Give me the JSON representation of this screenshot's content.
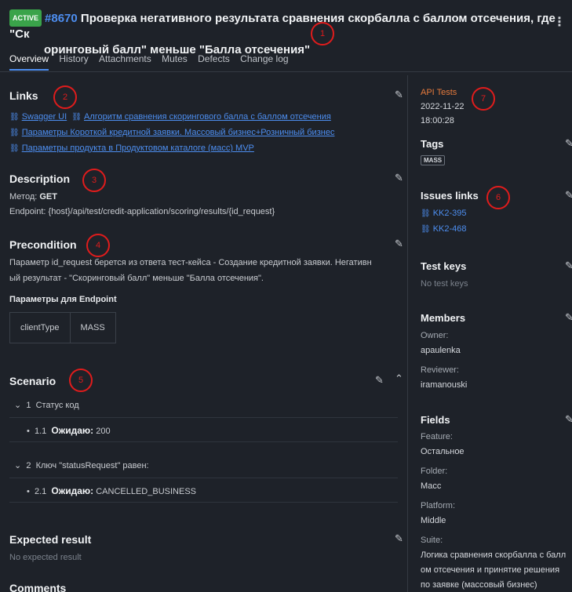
{
  "header": {
    "status": "ACTIVE",
    "id": "#8670",
    "title_line1": "Проверка негативного результата сравнения скорбалла с баллом отсечения, где \"Ск",
    "title_line2": "оринговый балл\" меньше \"Балла отсечения\"",
    "menu_icon": "kebab-icon"
  },
  "tabs": [
    "Overview",
    "History",
    "Attachments",
    "Mutes",
    "Defects",
    "Change log"
  ],
  "links": {
    "title": "Links",
    "items": [
      "Swagger UI",
      "Алгоритм сравнения скорингового балла с баллом отсечения",
      "Параметры Короткой кредитной заявки. Массовый бизнес+Розничный бизнес",
      "Параметры продукта в Продуктовом каталоге (масс) MVP"
    ]
  },
  "description": {
    "title": "Description",
    "method_label": "Метод:",
    "method_value": "GET",
    "endpoint": "Endpoint: {host}/api/test/credit-application/scoring/results/{id_request}"
  },
  "precondition": {
    "title": "Precondition",
    "line1": "Параметр id_request берется из ответа тест-кейса - Создание кредитной заявки. Негативн",
    "line2": "ый результат - \"Скоринговый балл\" меньше \"Балла отсечения\".",
    "params_title": "Параметры для Endpoint",
    "table": [
      "clientType",
      "MASS"
    ]
  },
  "scenario": {
    "title": "Scenario",
    "steps": [
      {
        "num": "1",
        "text": "Статус код",
        "sub_num": "1.1",
        "sub_label": "Ожидаю:",
        "sub_value": "200"
      },
      {
        "num": "2",
        "text": "Ключ \"statusRequest\" равен:",
        "sub_num": "2.1",
        "sub_label": "Ожидаю:",
        "sub_value": "CANCELLED_BUSINESS"
      }
    ]
  },
  "expected": {
    "title": "Expected result",
    "value": "No expected result"
  },
  "comments": {
    "title": "Comments"
  },
  "side": {
    "layer": "API Tests",
    "date": "2022-11-22",
    "time": "18:00:28",
    "tags_title": "Tags",
    "tag": "MASS",
    "issues_title": "Issues links",
    "issues": [
      "KK2-395",
      "KK2-468"
    ],
    "testkeys_title": "Test keys",
    "testkeys_value": "No test keys",
    "members_title": "Members",
    "owner_label": "Owner:",
    "owner": "apaulenka",
    "reviewer_label": "Reviewer:",
    "reviewer": "iramanouski",
    "fields_title": "Fields",
    "feature_label": "Feature:",
    "feature": "Остальное",
    "folder_label": "Folder:",
    "folder": "Масс",
    "platform_label": "Platform:",
    "platform": "Middle",
    "suite_label": "Suite:",
    "suite_1": "Логика сравнения скорбалла с балл",
    "suite_2": "ом отсечения и принятие решения",
    "suite_3": "по заявке (массовый бизнес)"
  },
  "annotations": [
    "1",
    "2",
    "3",
    "4",
    "5",
    "6",
    "7"
  ],
  "colors": {
    "accent": "#4d8ef0",
    "active_badge": "#3aa34a",
    "annotation": "#e01c1c",
    "background": "#1e2229"
  }
}
